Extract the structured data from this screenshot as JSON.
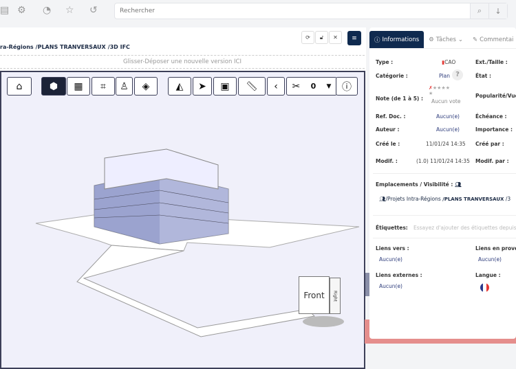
{
  "topbar": {
    "icons": [
      "folders-icon",
      "gears-icon",
      "rss-icon",
      "star-icon",
      "history-icon"
    ],
    "search_placeholder": "Rechercher",
    "search_icon": "search-icon",
    "download_icon": "arrow-down-icon"
  },
  "document": {
    "breadcrumb": [
      "ra-Régions",
      "/PLANS TRANVERSAUX",
      "/3D IFC"
    ],
    "drop_zone": "Glisser-Déposer une nouvelle version ICI",
    "controls": [
      "refresh-icon",
      "unlock-icon",
      "expand-icon",
      "menu-icon"
    ]
  },
  "viewer": {
    "toolbar": [
      "home",
      "cube-view",
      "grid",
      "crop",
      "person",
      "box-wireframe",
      "eraser",
      "pointer",
      "section-box",
      "measure",
      "chevron-left",
      "scissors",
      "info"
    ],
    "active_tool": "cube-view",
    "clip_count": "0",
    "navcube": {
      "front": "Front",
      "right": "Right"
    }
  },
  "panel": {
    "tabs": [
      {
        "label": "Informations",
        "icon": "info-icon"
      },
      {
        "label": "Tâches",
        "icon": "gears-icon"
      },
      {
        "label": "Commentai",
        "icon": "comment-icon"
      }
    ],
    "fields": {
      "type_label": "Type :",
      "type_value": "CAO",
      "categorie_label": "Catégorie :",
      "categorie_value": "Plan",
      "categorie_help": "?",
      "note_label": "Note (de 1 à 5) :",
      "note_value": "Aucun vote",
      "rating": 0,
      "ref_label": "Ref. Doc. :",
      "ref_value": "Aucun(e)",
      "auteur_label": "Auteur :",
      "auteur_value": "Aucun(e)",
      "cree_label": "Créé le :",
      "cree_value": "11/01/24 14:35",
      "modif_label": "Modif. :",
      "modif_value": "(1.0) 11/01/24 14:35",
      "ext_label": "Ext./Taille :",
      "etat_label": "État :",
      "popularite_label": "Popularité/Vue",
      "echeance_label": "Échéance :",
      "importance_label": "Importance :",
      "creepar_label": "Créé par :",
      "modifpar_label": "Modif. par :"
    },
    "emplacements_label": "Emplacements / Visibilité :",
    "emplacement_path": [
      "/Projets Intra-Régions",
      "/PLANS TRANVERSAUX",
      "/3"
    ],
    "etiquettes_label": "Étiquettes:",
    "etiquettes_placeholder": "Essayez d'ajouter des étiquettes depuis",
    "liens_vers_label": "Liens vers :",
    "liens_vers_value": "Aucun(e)",
    "liens_prov_label": "Liens en proven",
    "liens_prov_value": "Aucun(e)",
    "liens_ext_label": "Liens externes :",
    "liens_ext_value": "Aucun(e)",
    "langue_label": "Langue :",
    "langue_value": "fr-flag"
  },
  "colors": {
    "navy": "#0f2a4f",
    "accent_red": "#e53935",
    "footer": "#e58e8c",
    "link": "#2b3a7a"
  }
}
